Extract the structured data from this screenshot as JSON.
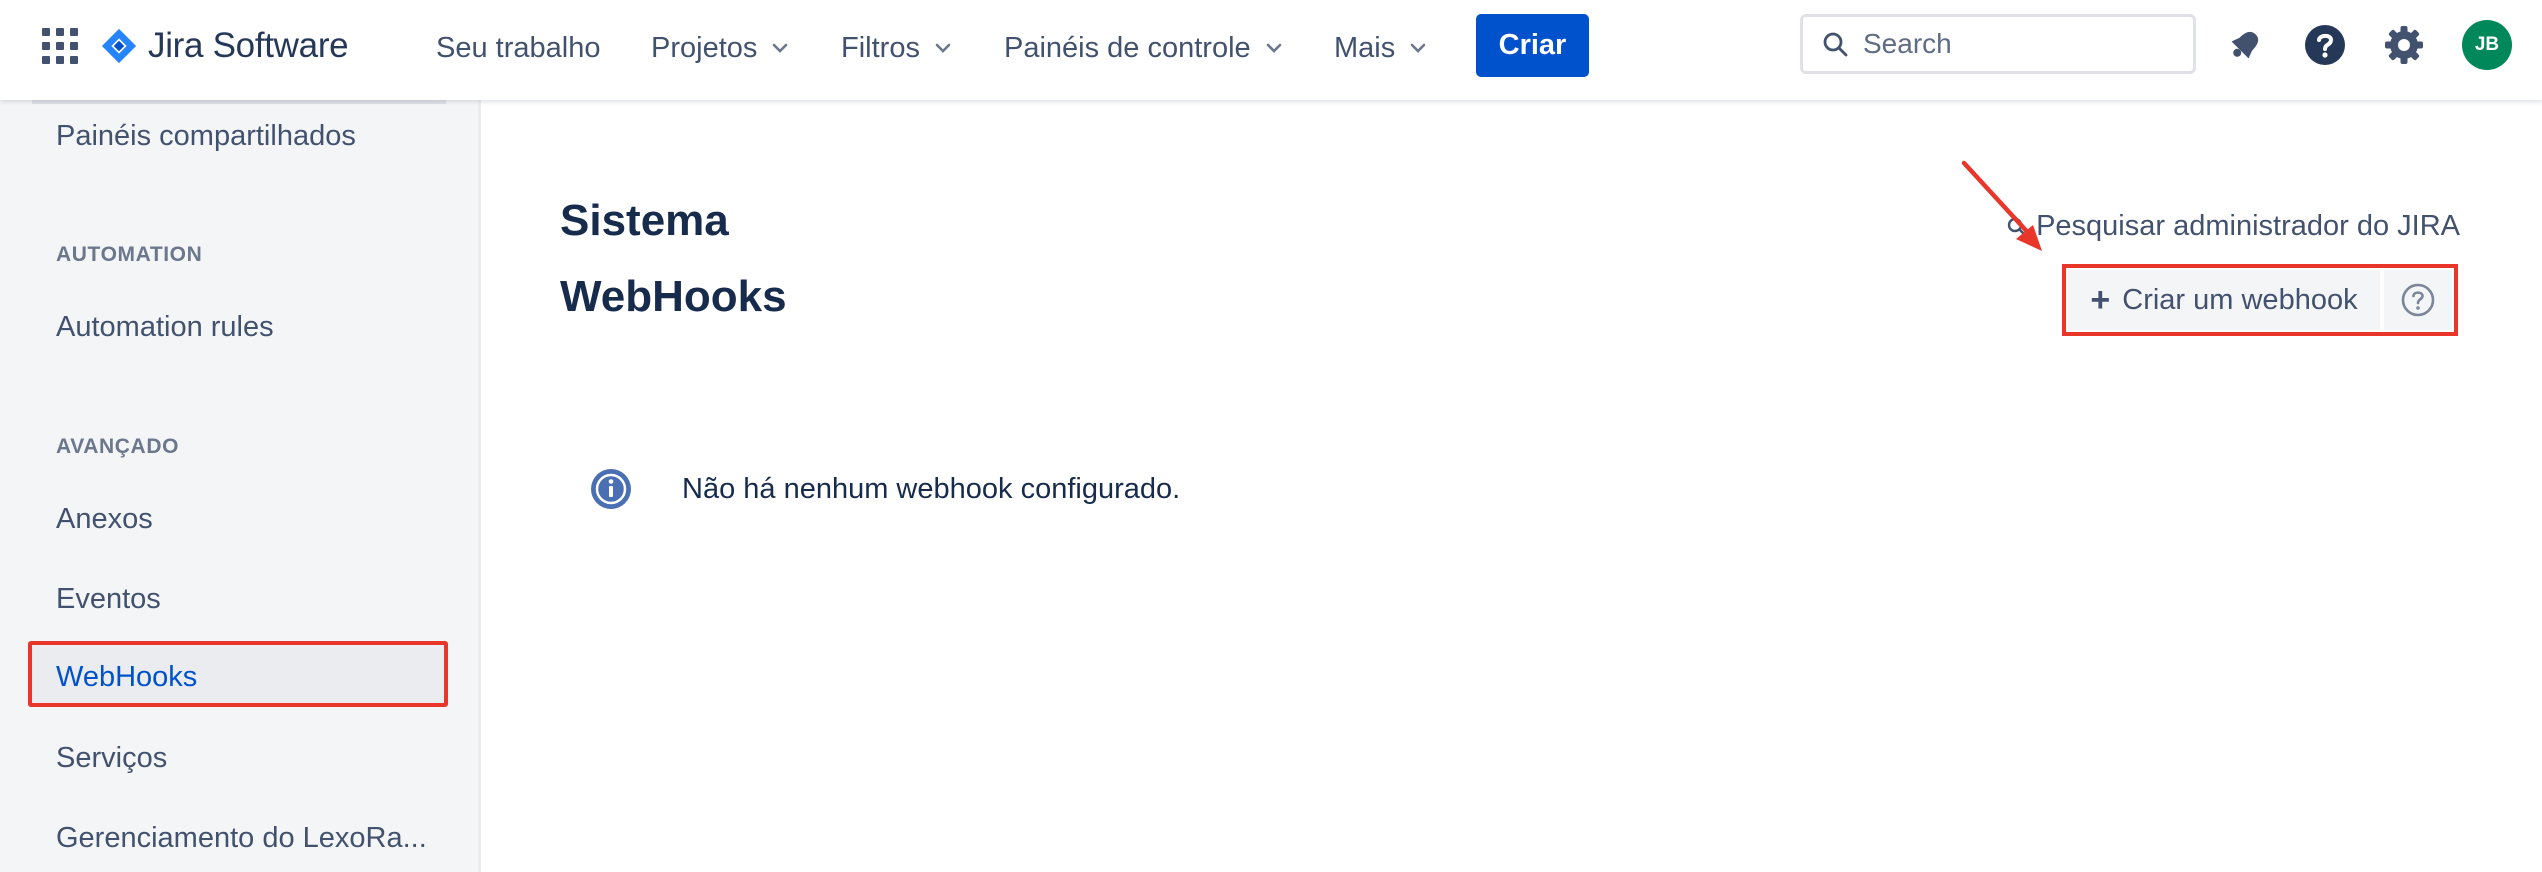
{
  "topnav": {
    "logo_text": "Jira Software",
    "items": [
      {
        "label": "Seu trabalho",
        "dropdown": false
      },
      {
        "label": "Projetos",
        "dropdown": true
      },
      {
        "label": "Filtros",
        "dropdown": true
      },
      {
        "label": "Painéis de controle",
        "dropdown": true
      },
      {
        "label": "Mais",
        "dropdown": true
      }
    ],
    "create_label": "Criar",
    "search_placeholder": "Search",
    "icons": [
      "app-switcher-icon",
      "notifications-icon",
      "help-icon",
      "settings-icon"
    ],
    "avatar_initials": "JB",
    "accent_color": "#0052cc",
    "avatar_color": "#00875a"
  },
  "sidebar": {
    "top_item": "Painéis compartilhados",
    "sections": [
      {
        "heading": "AUTOMATION",
        "items": [
          "Automation rules"
        ]
      },
      {
        "heading": "AVANÇADO",
        "items": [
          "Anexos",
          "Eventos",
          "WebHooks",
          "Serviços",
          "Gerenciamento do LexoRa..."
        ]
      }
    ],
    "selected_item": "WebHooks"
  },
  "main": {
    "section_title": "Sistema",
    "page_title": "WebHooks",
    "admin_search_label": "Pesquisar administrador do JIRA",
    "create_webhook_label": "Criar um webhook",
    "empty_message": "Não há nenhum webhook configurado.",
    "highlight_color": "#e8362b"
  }
}
